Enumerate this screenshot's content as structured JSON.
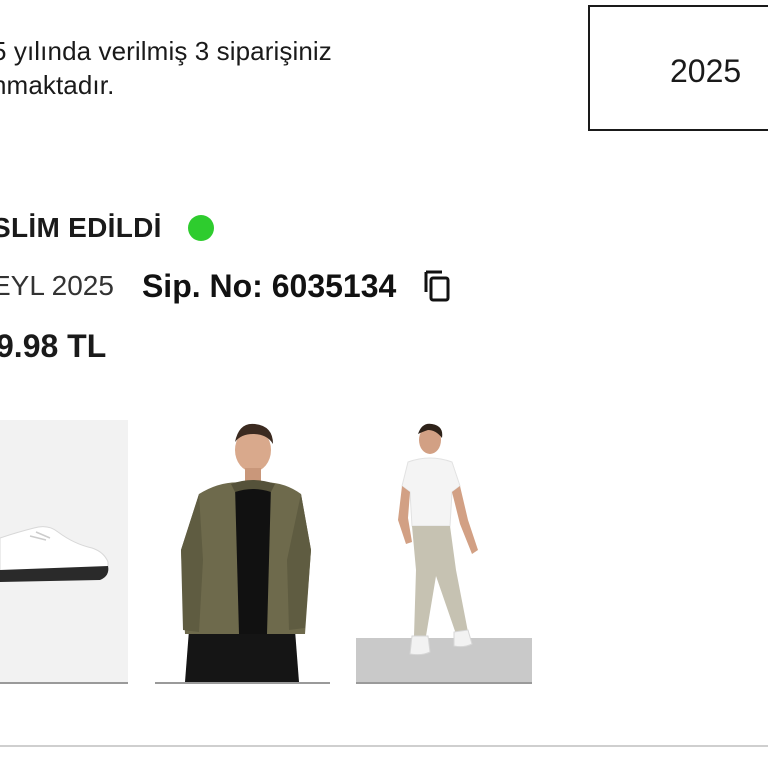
{
  "summary": {
    "line1": "5 yılında verilmiş 3 siparişiniz",
    "line2": "nmaktadır."
  },
  "year_filter": {
    "selected": "2025"
  },
  "order": {
    "status": "SLİM EDİLDİ",
    "status_color": "#2ecc2e",
    "date": "EYL 2025",
    "order_number": "Sip. No: 6035134",
    "total": "9.98 TL"
  },
  "products": [
    {
      "icon": "white-sneaker-image"
    },
    {
      "icon": "olive-bomber-jacket-image"
    },
    {
      "icon": "beige-chino-pants-image"
    }
  ]
}
